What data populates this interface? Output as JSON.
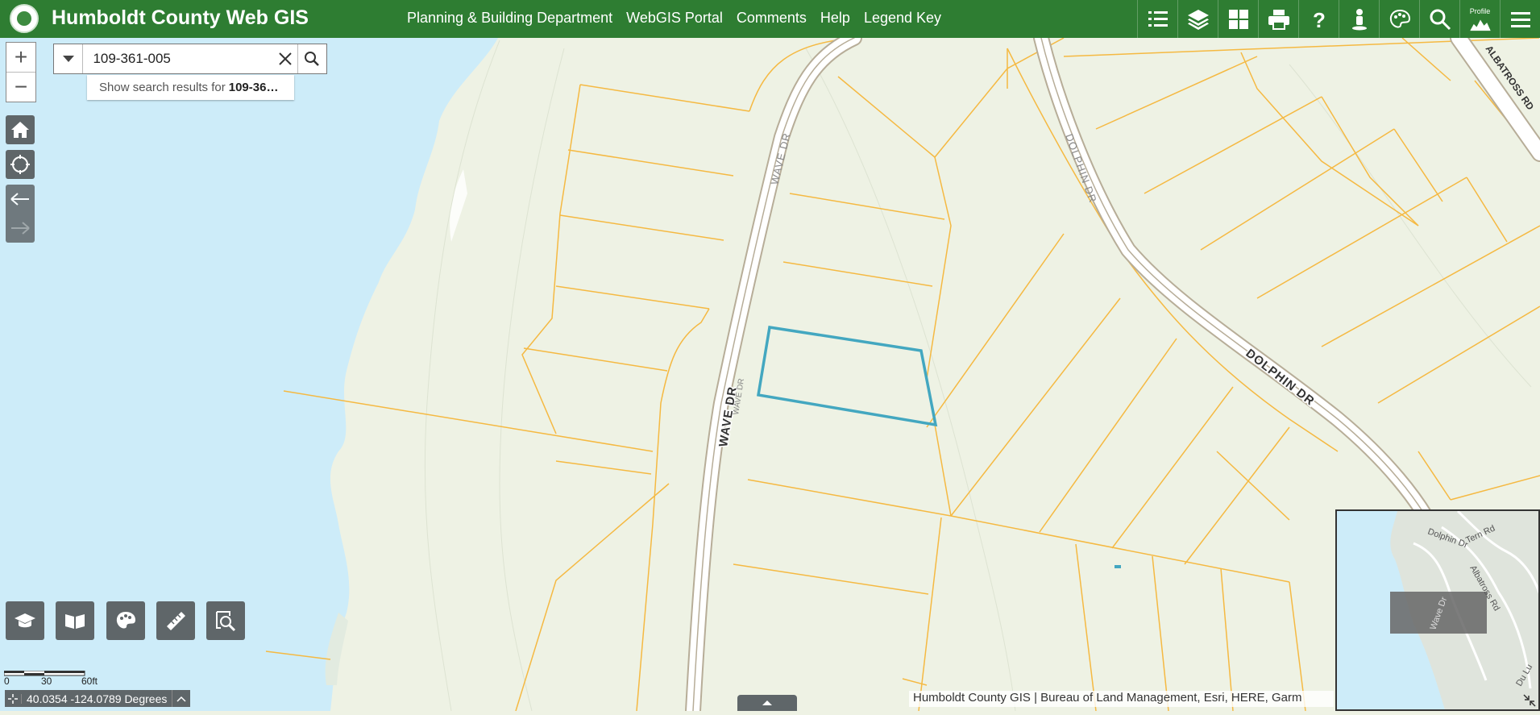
{
  "header": {
    "title": "Humboldt County Web GIS",
    "nav": [
      "Planning & Building Department",
      "WebGIS Portal",
      "Comments",
      "Help",
      "Legend Key"
    ],
    "tools": [
      "legend-list-icon",
      "layers-icon",
      "basemap-gallery-icon",
      "print-icon",
      "help-icon",
      "street-view-icon",
      "draw-icon",
      "search-icon",
      "profile-icon",
      "menu-icon"
    ],
    "profile_label": "Profile"
  },
  "map_controls": {
    "zoom_in": "+",
    "zoom_out": "−"
  },
  "search": {
    "value": "109-361-005",
    "suggestion_prefix": "Show search results for",
    "suggestion_term": "109-36…"
  },
  "streets": {
    "wave_dr_main": "WAVE DR",
    "wave_dr_small": "WAVE DR",
    "wave_dr_top": "WAVE DR",
    "dolphin_dr_main": "DOLPHIN DR",
    "dolphin_dr_top": "DOLPHIN DR",
    "albatross_rd": "ALBATROSS RD"
  },
  "overview_labels": [
    "Dolphin Dr",
    "Tern Rd",
    "Albatross Rd",
    "Wave Dr",
    "Du Lu"
  ],
  "scalebar": {
    "zero": "0",
    "mid": "30",
    "end": "60ft"
  },
  "coordinates": "40.0354 -124.0789 Degrees",
  "attribution": "Humboldt County GIS | Bureau of Land Management, Esri, HERE, Garm",
  "colors": {
    "header": "#2e7d32",
    "water": "#cdecf9",
    "land": "#eef2e4",
    "parcel_line": "#f5b942",
    "selected_parcel": "#43a7c0",
    "road": "#ffffff",
    "road_edge": "#b7ad98"
  }
}
